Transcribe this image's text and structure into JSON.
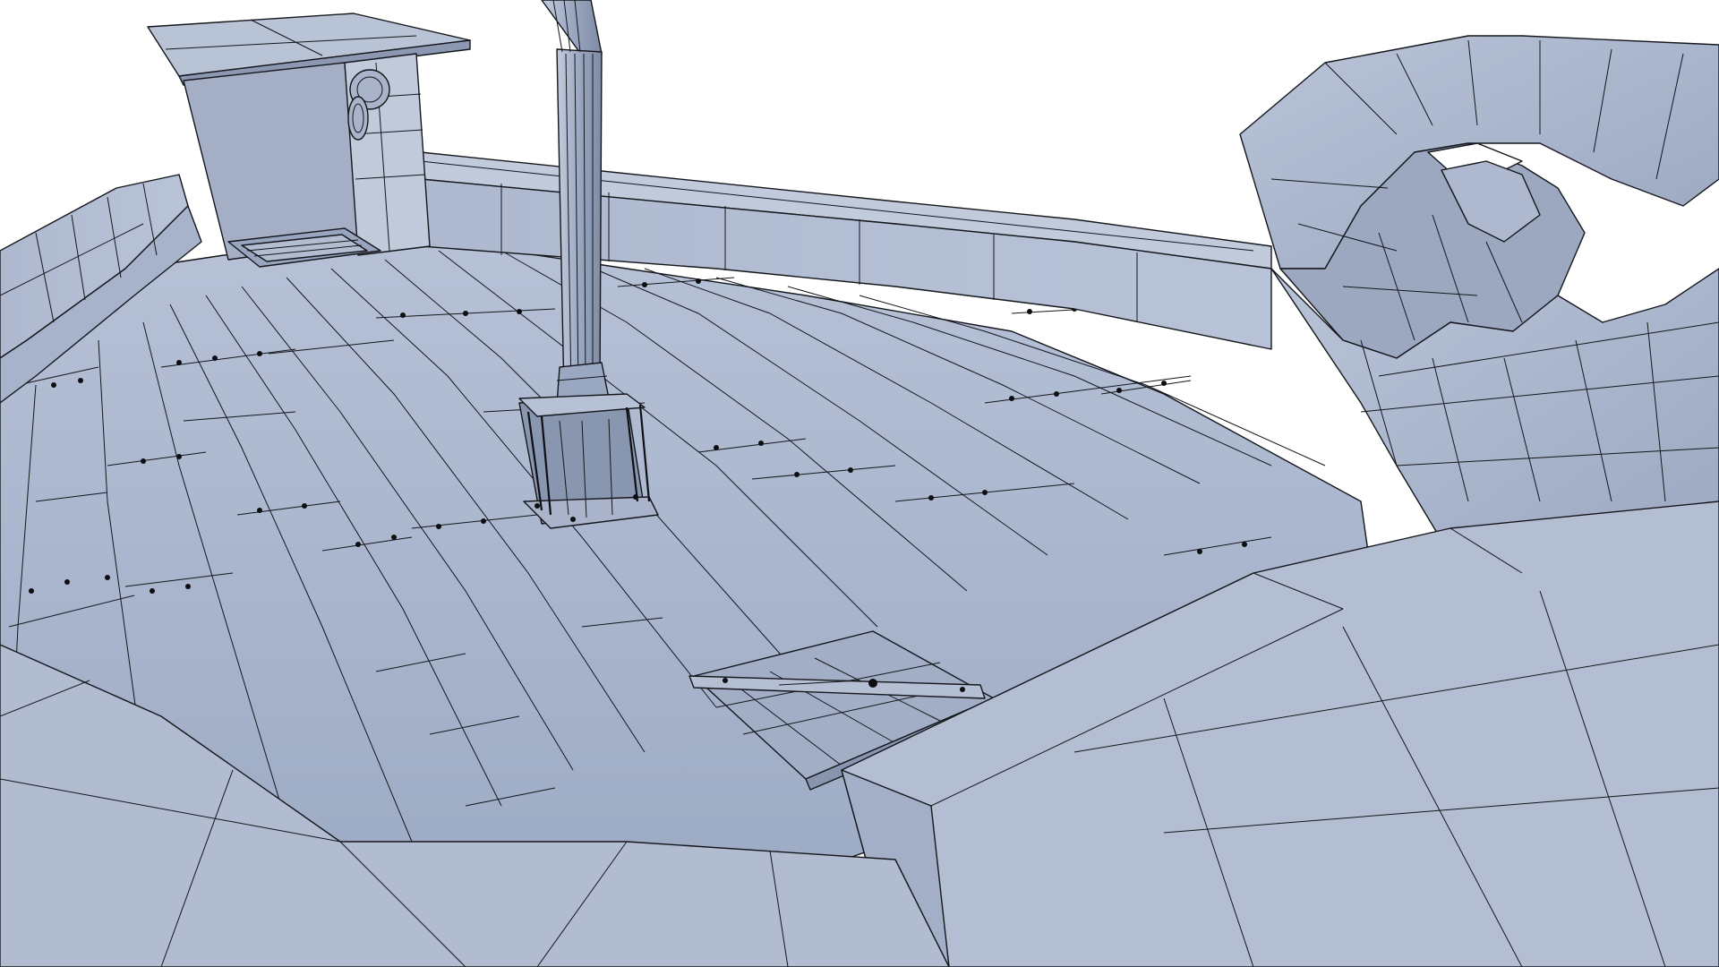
{
  "scene": {
    "type": "3d-wireframe-render",
    "subject": "boat deck",
    "background_color": "#ffffff",
    "shading_colors": {
      "deck": "#a3b0c8",
      "deck_light": "#b3bfd4",
      "deck_dark": "#8f9cb6",
      "hull": "#b0bbd1",
      "hull_shadow": "#8e9ab2",
      "wire": "#14161c"
    }
  }
}
